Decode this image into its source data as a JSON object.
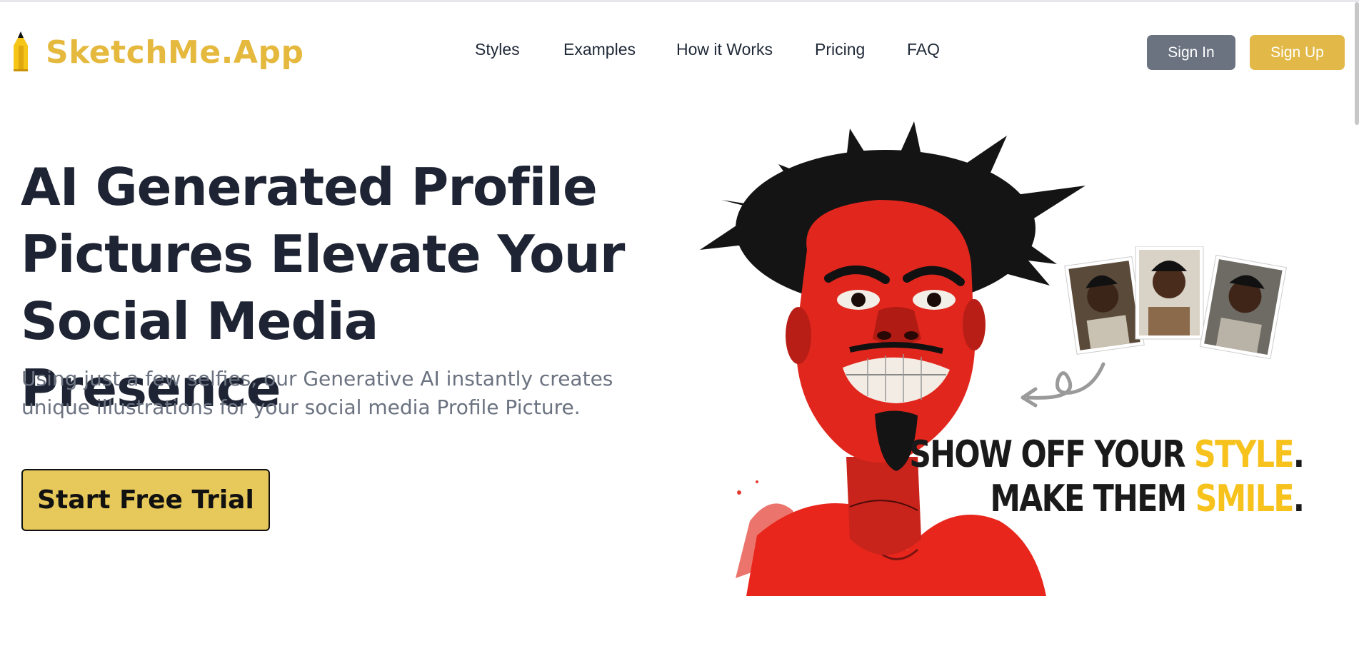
{
  "brand": {
    "name": "SketchMe.App",
    "color": "#e5b93e"
  },
  "nav": {
    "items": [
      {
        "label": "Styles"
      },
      {
        "label": "Examples"
      },
      {
        "label": "How it Works"
      },
      {
        "label": "Pricing"
      },
      {
        "label": "FAQ"
      }
    ]
  },
  "auth": {
    "signin_label": "Sign In",
    "signup_label": "Sign Up"
  },
  "hero": {
    "headline": "AI Generated Profile Pictures Elevate Your Social Media Presence",
    "subtext": "Using just a few selfies, our Generative AI instantly creates unique illustrations for your social media Profile Picture.",
    "cta_label": "Start Free Trial"
  },
  "illustration": {
    "slogan_line1_prefix": "SHOW OFF YOUR ",
    "slogan_line1_highlight": "STYLE",
    "slogan_line2_prefix": "MAKE THEM ",
    "slogan_line2_highlight": "SMILE",
    "period": ".",
    "highlight_color": "#f6c21b"
  },
  "colors": {
    "cta": "#e7c85a",
    "signin_bg": "#6b7280",
    "signup_bg": "#e2b948",
    "heading": "#1e2433"
  }
}
